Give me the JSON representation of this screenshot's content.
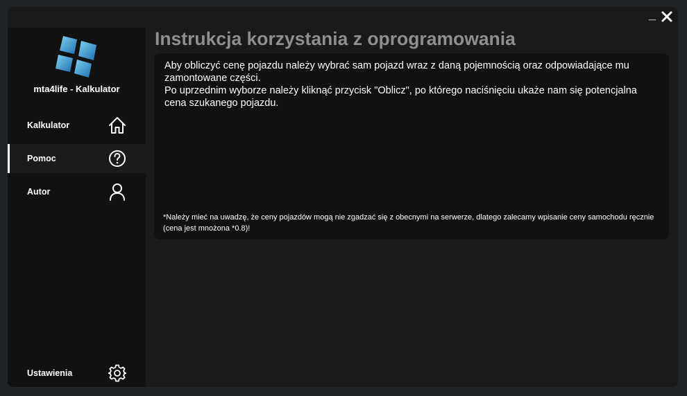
{
  "window": {
    "minimize_label": "_",
    "close_icon": "close-icon"
  },
  "sidebar": {
    "logo_icon": "windows-tiles-logo",
    "app_title": "mta4life - Kalkulator",
    "items": [
      {
        "label": "Kalkulator",
        "icon": "home-icon",
        "active": false
      },
      {
        "label": "Pomoc",
        "icon": "help-circle-icon",
        "active": true
      },
      {
        "label": "Autor",
        "icon": "user-icon",
        "active": false
      }
    ],
    "settings": {
      "label": "Ustawienia",
      "icon": "gear-icon"
    }
  },
  "main": {
    "title": "Instrukcja korzystania z oprogramowania",
    "paragraph1": "Aby obliczyć cenę pojazdu należy wybrać sam pojazd wraz z daną pojemnością oraz odpowiadające mu zamontowane części.",
    "paragraph2": "Po uprzednim wyborze należy kliknąć przycisk \"Oblicz\", po którego naciśnięciu ukaże nam się potencjalna cena szukanego pojazdu.",
    "note": "*Należy mieć na uwadzę, że ceny pojazdów mogą nie zgadzać się z obecnymi na serwerze, dlatego zalecamy wpisanie ceny samochodu ręcznie (cena jest mnożona *0.8)!"
  },
  "colors": {
    "background": "#1a1a1a",
    "sidebar": "#111111",
    "title_gray": "#8e8e8e",
    "logo_blue": "#3aa0d8"
  }
}
